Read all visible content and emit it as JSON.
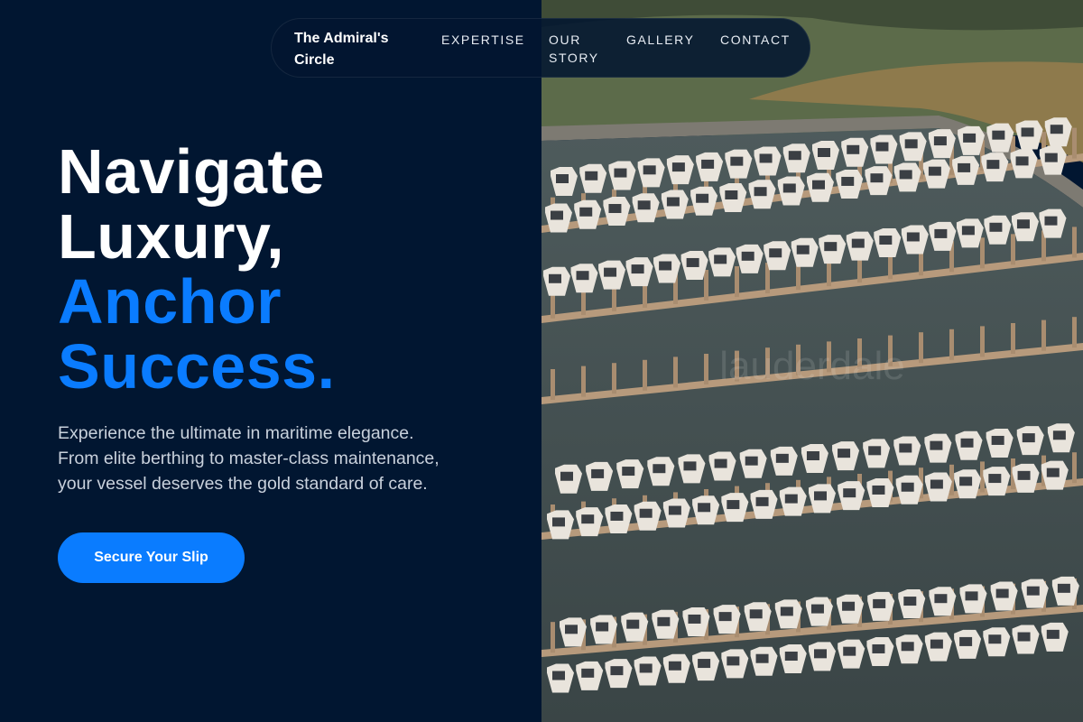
{
  "nav": {
    "brand": "The Admiral's Circle",
    "links": [
      "EXPERTISE",
      "OUR STORY",
      "GALLERY",
      "CONTACT"
    ]
  },
  "hero": {
    "title_lines": [
      "Navigate",
      "Luxury,"
    ],
    "accent_lines": [
      "Anchor",
      "Success."
    ],
    "subtitle_lines": [
      "Experience the ultimate in maritime elegance.",
      "From elite berthing to master-class maintenance,",
      "your vessel deserves the gold standard of care."
    ],
    "cta_label": "Secure Your Slip"
  },
  "image": {
    "subject": "aerial-marina-photo",
    "watermark": "lauderdale"
  },
  "colors": {
    "background": "#011631",
    "accent": "#0a7cff",
    "text": "#ffffff"
  }
}
